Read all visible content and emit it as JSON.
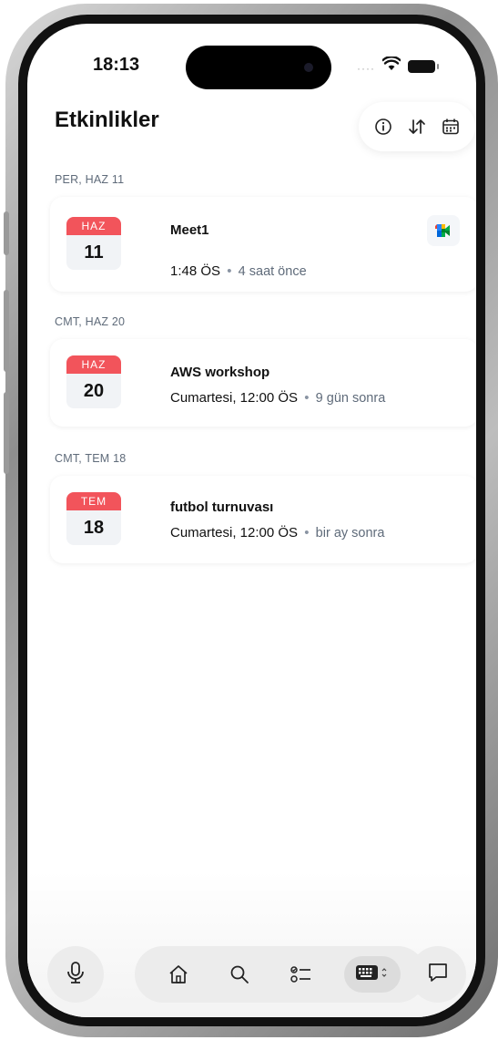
{
  "status_bar": {
    "time": "18:13"
  },
  "header": {
    "title": "Etkinlikler"
  },
  "toolbar": {
    "icons": [
      "info-icon",
      "sort-icon",
      "calendar-icon"
    ]
  },
  "sections": [
    {
      "header": "PER, HAZ 11",
      "event": {
        "month": "HAZ",
        "day": "11",
        "title": "Meet1",
        "time": "1:48 ÖS",
        "separator": "•",
        "relative": "4 saat önce",
        "icon": "google-meet-icon"
      }
    },
    {
      "header": "CMT, HAZ 20",
      "event": {
        "month": "HAZ",
        "day": "20",
        "title": "AWS workshop",
        "time": "Cumartesi, 12:00 ÖS",
        "separator": "•",
        "relative": "9 gün sonra"
      }
    },
    {
      "header": "CMT, TEM 18",
      "event": {
        "month": "TEM",
        "day": "18",
        "title": "futbol turnuvası",
        "time": "Cumartesi, 12:00 ÖS",
        "separator": "•",
        "relative": "bir ay sonra"
      }
    }
  ],
  "bottom_nav": {
    "items": [
      "microphone-icon",
      "home-icon",
      "search-icon",
      "checklist-icon",
      "keyboard-icon",
      "chat-icon"
    ],
    "active": "keyboard-icon"
  },
  "colors": {
    "month_badge": "#f2545b",
    "accent_text": "#111111",
    "muted_text": "#5f6b7a"
  }
}
